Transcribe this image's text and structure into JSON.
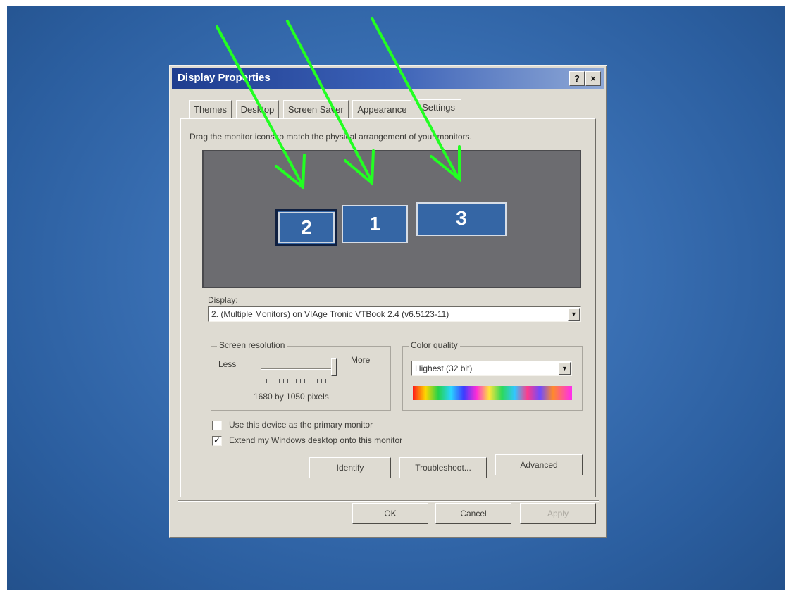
{
  "dialog": {
    "title": "Display Properties",
    "help_button": "?",
    "close_button": "×"
  },
  "tabs": [
    {
      "label": "Themes"
    },
    {
      "label": "Desktop"
    },
    {
      "label": "Screen Saver"
    },
    {
      "label": "Appearance"
    },
    {
      "label": "Settings"
    }
  ],
  "settings": {
    "instruction": "Drag the monitor icons to match the physical arrangement of your monitors.",
    "monitors": {
      "left": "2",
      "middle": "1",
      "right": "3"
    },
    "display_label": "Display:",
    "display_value": "2. (Multiple Monitors) on VIAge Tronic VTBook 2.4 (v6.5123-11)",
    "resolution": {
      "title": "Screen resolution",
      "less": "Less",
      "more": "More",
      "value_text": "1680 by 1050 pixels"
    },
    "color_quality": {
      "title": "Color quality",
      "value": "Highest (32 bit)"
    },
    "checkbox_primary": {
      "label": "Use this device as the primary monitor",
      "checked": false
    },
    "checkbox_extend": {
      "label": "Extend my Windows desktop onto this monitor",
      "checked": true,
      "mark": "✓"
    },
    "buttons": {
      "identify": "Identify",
      "troubleshoot": "Troubleshoot...",
      "advanced": "Advanced"
    }
  },
  "footer": {
    "ok": "OK",
    "cancel": "Cancel",
    "apply": "Apply"
  },
  "colors": {
    "desktop": "#3a70b4",
    "dialog": "#dedbd2",
    "monitor_area": "#6c6c70",
    "monitor_icon": "#3566a5",
    "arrow": "#22ff22"
  }
}
